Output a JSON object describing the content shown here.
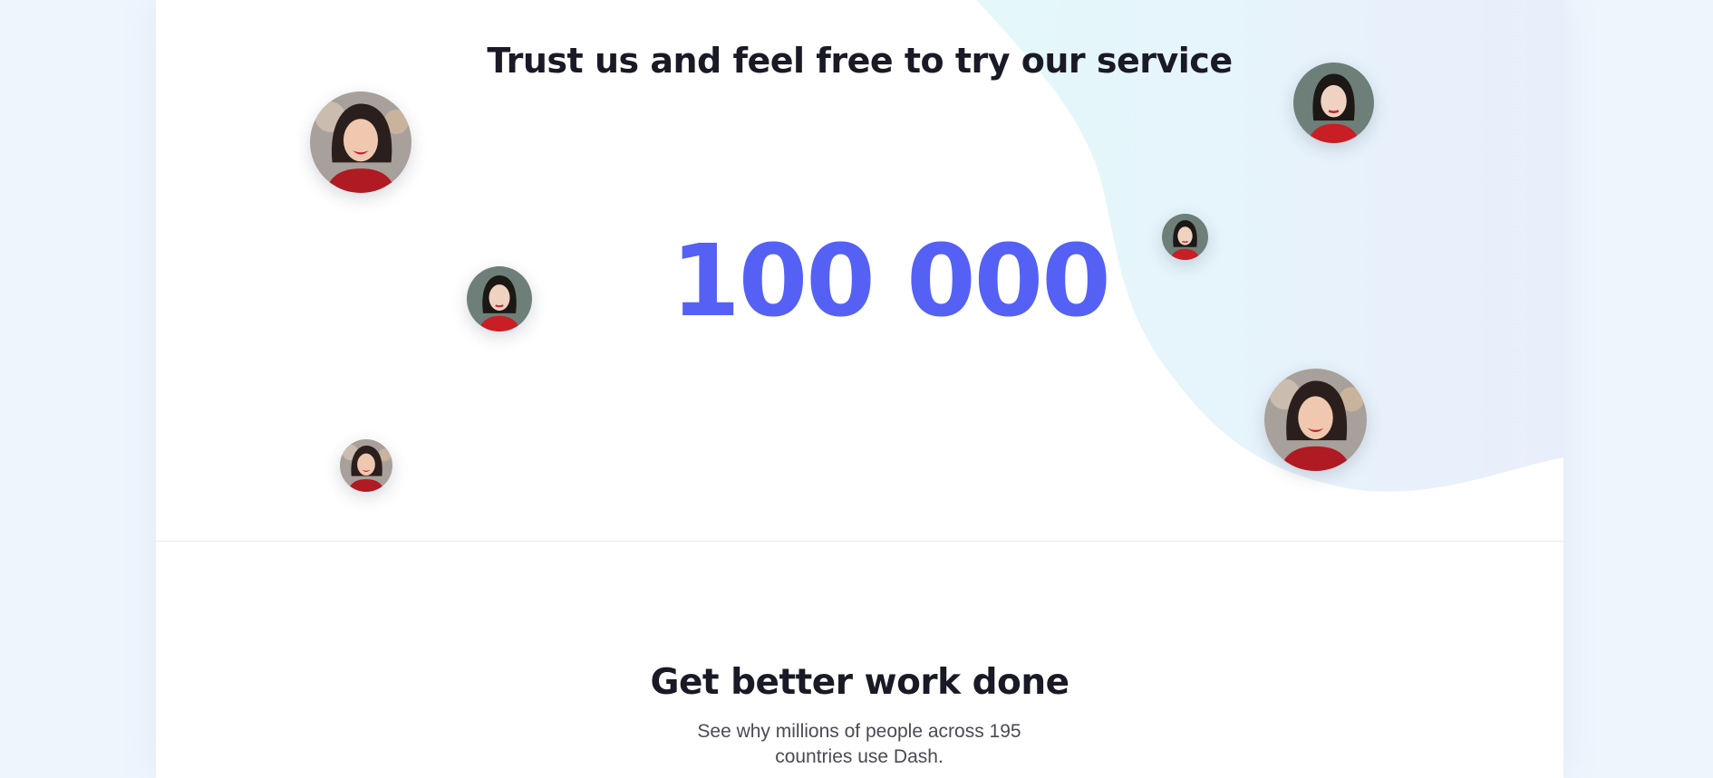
{
  "trust": {
    "title": "Trust us and feel free to try our service",
    "count": "100 000"
  },
  "avatars": [
    {
      "name": "avatar-smiling-woman",
      "style": "smile"
    },
    {
      "name": "avatar-serious-woman",
      "style": "serious"
    }
  ],
  "features": {
    "title": "Get better work done",
    "subtitle": "See why millions of people across 195 countries use Dash."
  },
  "colors": {
    "accent": "#5561f5",
    "heading": "#1a1a26",
    "page_bg": "#eef5fd",
    "blob": "#e6f6fb"
  }
}
